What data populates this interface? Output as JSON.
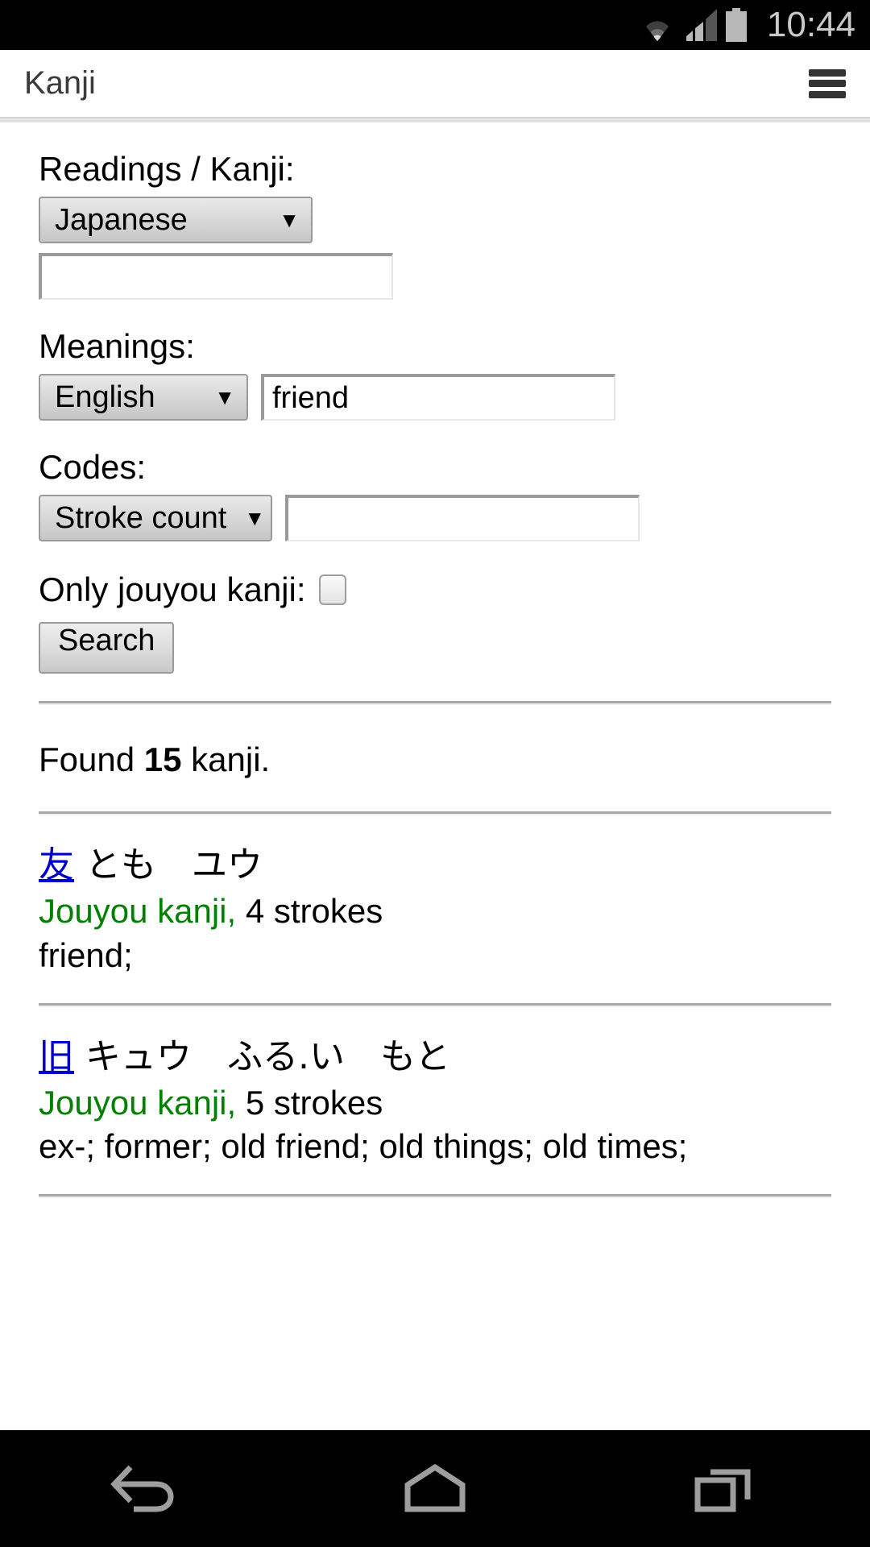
{
  "status_bar": {
    "time": "10:44",
    "icons": [
      "wifi-icon",
      "signal-icon",
      "battery-icon"
    ]
  },
  "app_bar": {
    "title": "Kanji",
    "menu_icon": "hamburger-menu-icon"
  },
  "form": {
    "readings": {
      "label": "Readings / Kanji:",
      "select_value": "Japanese",
      "input_value": "",
      "input_placeholder": ""
    },
    "meanings": {
      "label": "Meanings:",
      "select_value": "English",
      "input_value": "friend",
      "input_placeholder": ""
    },
    "codes": {
      "label": "Codes:",
      "select_value": "Stroke count",
      "input_value": "",
      "input_placeholder": ""
    },
    "only_jouyou": {
      "label": "Only jouyou kanji:",
      "checked": false
    },
    "search_button": "Search"
  },
  "results": {
    "found_prefix": "Found ",
    "found_count": "15",
    "found_suffix": " kanji.",
    "items": [
      {
        "kanji": "友",
        "readings": "とも　ユウ",
        "jouyou_label": "Jouyou kanji,",
        "strokes": " 4 strokes",
        "meanings": "friend;"
      },
      {
        "kanji": "旧",
        "readings": "キュウ　ふる.い　もと",
        "jouyou_label": "Jouyou kanji,",
        "strokes": " 5 strokes",
        "meanings": "ex-;  former;  old friend;  old things;  old times;"
      }
    ]
  },
  "nav_bar": {
    "back": "back-icon",
    "home": "home-icon",
    "recents": "recent-apps-icon"
  },
  "colors": {
    "link": "#0000cc",
    "jouyou_green": "#008000",
    "status_bg": "#000000",
    "nav_icon": "#9e9e9e"
  }
}
